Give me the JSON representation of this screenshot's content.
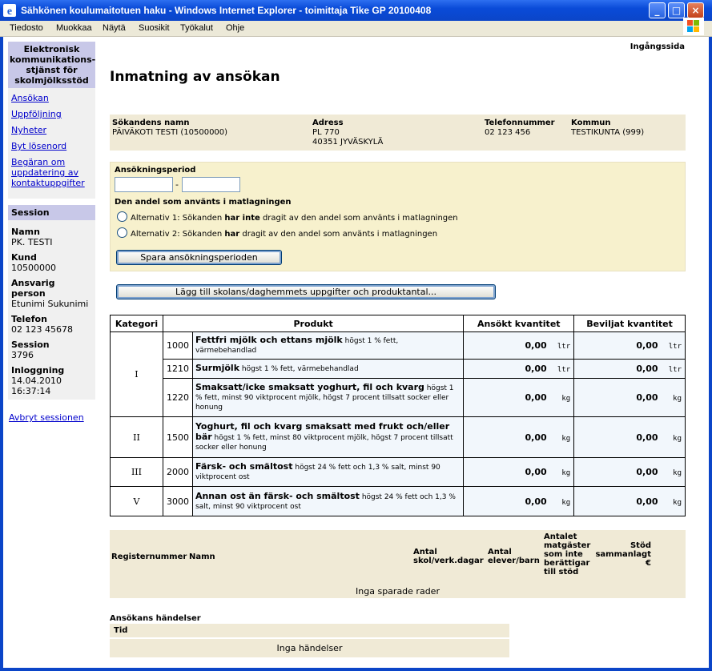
{
  "window": {
    "title": "Sähkönen koulumaitotuen haku - Windows Internet Explorer - toimittaja Tike GP 20100408",
    "minimize": "_",
    "maximize": "□",
    "close": "×"
  },
  "menu": [
    "Tiedosto",
    "Muokkaa",
    "Näytä",
    "Suosikit",
    "Työkalut",
    "Ohje"
  ],
  "sidebar": {
    "header": "Elektronisk kommunikations-stjänst för skolmjölksstöd",
    "links": [
      "Ansökan",
      "Uppföljning",
      "Nyheter",
      "Byt lösenord",
      "Begäran om uppdatering av kontaktuppgifter"
    ],
    "session_header": "Session",
    "session": [
      {
        "label": "Namn",
        "value": "PK. TESTI"
      },
      {
        "label": "Kund",
        "value": "10500000"
      },
      {
        "label": "Ansvarig person",
        "value": "Etunimi Sukunimi"
      },
      {
        "label": "Telefon",
        "value": "02 123 45678"
      },
      {
        "label": "Session",
        "value": "3796"
      },
      {
        "label": "Inloggning",
        "value": "14.04.2010",
        "value2": "16:37:14"
      }
    ],
    "abort": "Avbryt sessionen"
  },
  "main": {
    "top_link": "Ingångssida",
    "title": "Inmatning av ansökan",
    "applicant": {
      "name_label": "Sökandens namn",
      "name": "PÄIVÄKOTI TESTI (10500000)",
      "address_label": "Adress",
      "address1": "PL 770",
      "address2": "40351 JYVÄSKYLÄ",
      "phone_label": "Telefonnummer",
      "phone": "02 123 456",
      "municipality_label": "Kommun",
      "municipality": "TESTIKUNTA (999)"
    },
    "period": {
      "label": "Ansökningsperiod",
      "start": "",
      "separator": "-",
      "end": "",
      "share_label": "Den andel som använts i matlagningen",
      "alt1_pre": "Alternativ 1: Sökanden ",
      "alt1_bold": "har inte",
      "alt1_post": " dragit av den andel som använts i matlagningen",
      "alt2_pre": "Alternativ 2: Sökanden ",
      "alt2_bold": "har",
      "alt2_post": " dragit av den andel som använts i matlagningen",
      "save_button": "Spara ansökningsperioden"
    },
    "add_button": "Lägg till skolans/daghemmets uppgifter och produktantal...",
    "products": {
      "headers": [
        "Kategori",
        "Produkt",
        "Ansökt kvantitet",
        "Beviljat kvantitet"
      ],
      "rows": [
        {
          "cat": "I",
          "code": "1000",
          "name": "Fettfri mjölk och ettans mjölk",
          "desc": " högst 1 % fett, värmebehandlad",
          "applied": "0,00",
          "granted": "0,00",
          "unit": "ltr"
        },
        {
          "cat": "",
          "code": "1210",
          "name": "Surmjölk",
          "desc": " högst 1 % fett, värmebehandlad",
          "applied": "0,00",
          "granted": "0,00",
          "unit": "ltr"
        },
        {
          "cat": "",
          "code": "1220",
          "name": "Smaksatt/icke smaksatt yoghurt, fil och kvarg",
          "desc": " högst 1 % fett, minst 90 viktprocent mjölk, högst 7 procent tillsatt socker eller honung",
          "applied": "0,00",
          "granted": "0,00",
          "unit": "kg"
        },
        {
          "cat": "II",
          "code": "1500",
          "name": "Yoghurt, fil och kvarg smaksatt med frukt och/eller bär",
          "desc": " högst 1 % fett, minst 80 viktprocent mjölk, högst 7 procent tillsatt socker eller honung",
          "applied": "0,00",
          "granted": "0,00",
          "unit": "kg"
        },
        {
          "cat": "III",
          "code": "2000",
          "name": "Färsk- och smältost",
          "desc": " högst 24 % fett och 1,3 % salt, minst 90 viktprocent ost",
          "applied": "0,00",
          "granted": "0,00",
          "unit": "kg"
        },
        {
          "cat": "V",
          "code": "3000",
          "name": "Annan ost än färsk- och smältost",
          "desc": " högst 24 % fett och 1,3 % salt, minst 90 viktprocent ost",
          "applied": "0,00",
          "granted": "0,00",
          "unit": "kg"
        }
      ]
    },
    "register": {
      "headers": [
        "Registernummer",
        "Namn",
        "Antal skol/verk.dagar",
        "Antal elever/barn",
        "Antalet matgäster som inte berättigar till stöd",
        "Stöd sammanlagt €"
      ],
      "empty": "Inga sparade rader"
    },
    "events": {
      "title": "Ansökans händelser",
      "col": "Tid",
      "empty": "Inga händelser"
    }
  }
}
